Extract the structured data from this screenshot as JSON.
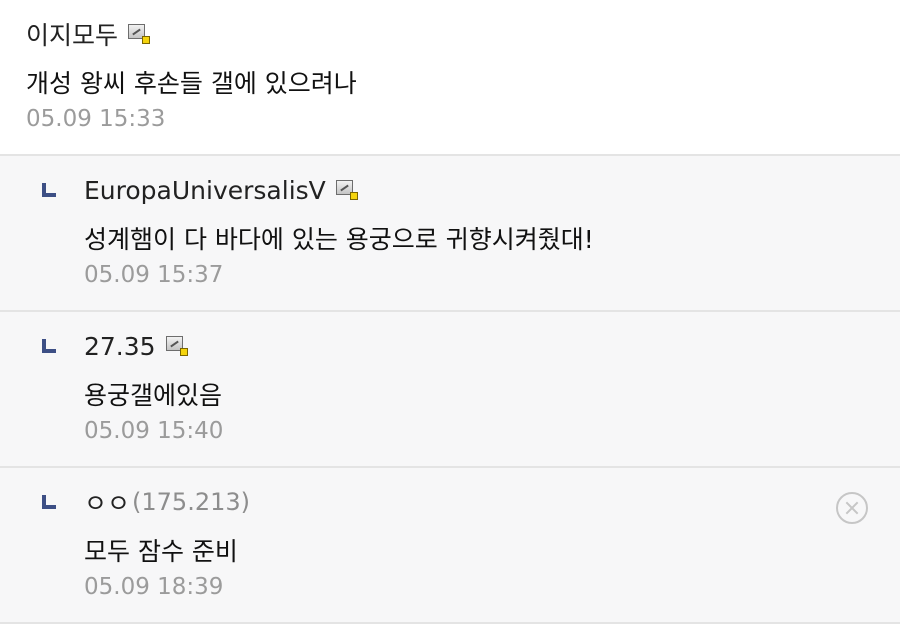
{
  "comments": [
    {
      "author": "이지모두",
      "author_badge_icon": "gallery-member-icon",
      "text": "개성 왕씨 후손들 갤에 있으려나",
      "time": "05.09 15:33"
    }
  ],
  "replies": [
    {
      "author": "EuropaUniversalisV",
      "author_badge_icon": "gallery-member-icon",
      "text": "성계햄이 다 바다에 있는 용궁으로 귀향시켜줬대!",
      "time": "05.09 15:37"
    },
    {
      "author": "27.35",
      "author_badge_icon": "gallery-member-icon",
      "text": "용궁갤에있음",
      "time": "05.09 15:40"
    },
    {
      "author": "ㅇㅇ",
      "ip": "(175.213)",
      "text": "모두 잠수 준비",
      "time": "05.09 18:39",
      "delete_icon": "close-circle-icon"
    }
  ],
  "colors": {
    "reply_marker": "#3d4f85",
    "reply_background": "#f7f7f8",
    "timestamp": "#9b9b9b",
    "divider": "#e4e4e4"
  }
}
